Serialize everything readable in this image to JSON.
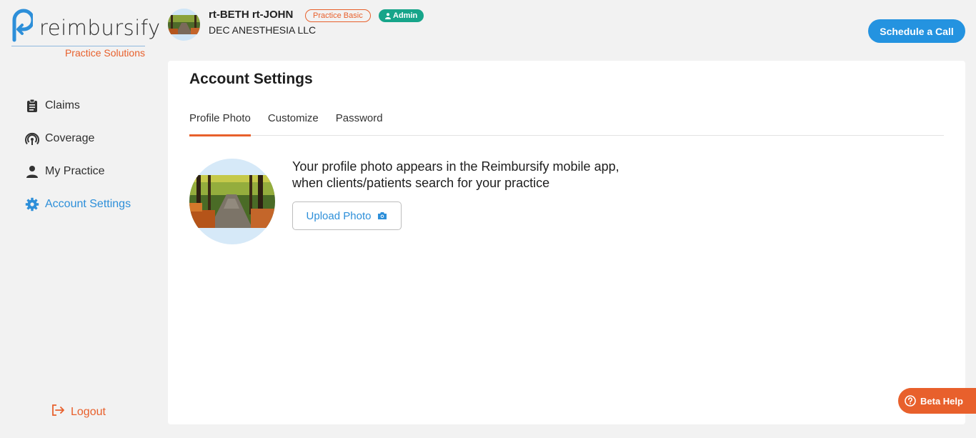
{
  "brand": {
    "name": "reimbursify",
    "subtitle": "Practice Solutions"
  },
  "sidebar": {
    "items": [
      {
        "label": "Claims",
        "icon": "clipboard-icon"
      },
      {
        "label": "Coverage",
        "icon": "signal-icon"
      },
      {
        "label": "My Practice",
        "icon": "person-icon"
      },
      {
        "label": "Account Settings",
        "icon": "gear-icon",
        "active": true
      }
    ],
    "logout_label": "Logout"
  },
  "header": {
    "user_name": "rt-BETH rt-JOHN",
    "plan_badge": "Practice Basic",
    "role_badge": "Admin",
    "organization": "DEC ANESTHESIA LLC",
    "schedule_button": "Schedule a Call"
  },
  "main": {
    "title": "Account Settings",
    "tabs": [
      {
        "label": "Profile Photo",
        "active": true
      },
      {
        "label": "Customize"
      },
      {
        "label": "Password"
      }
    ],
    "photo_description_line1": "Your profile photo appears in the Reimbursify mobile app,",
    "photo_description_line2": "when clients/patients search for your practice",
    "upload_button": "Upload Photo"
  },
  "help": {
    "label": "Beta Help"
  },
  "colors": {
    "accent_orange": "#e8602c",
    "accent_blue": "#2493e0",
    "admin_green": "#17a58a",
    "background": "#f2f2f2"
  }
}
